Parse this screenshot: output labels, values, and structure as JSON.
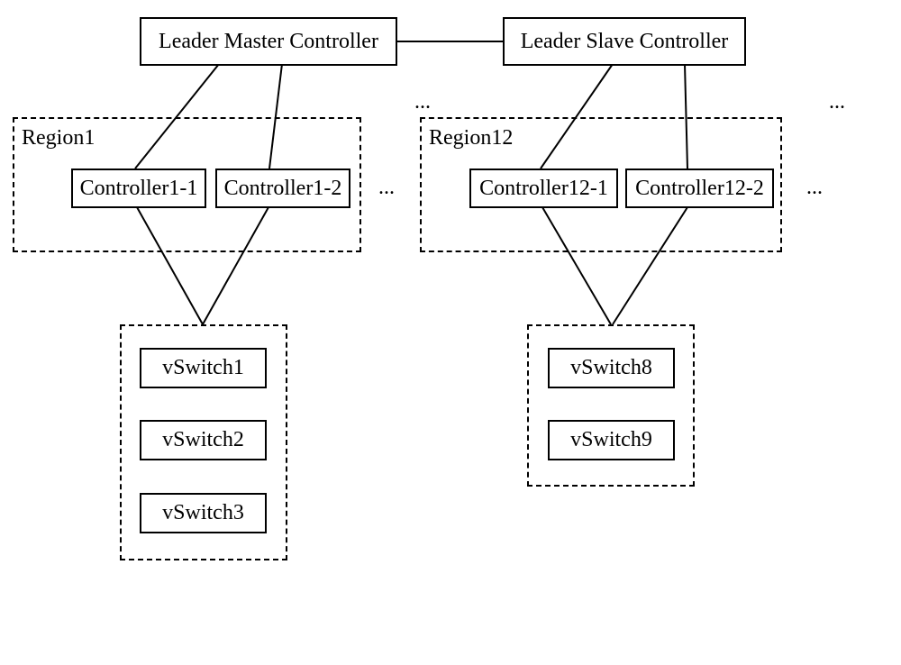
{
  "leaders": {
    "master": "Leader Master Controller",
    "slave": "Leader Slave Controller"
  },
  "region1": {
    "label": "Region1",
    "controllers": [
      "Controller1-1",
      "Controller1-2"
    ]
  },
  "region12": {
    "label": "Region12",
    "controllers": [
      "Controller12-1",
      "Controller12-2"
    ]
  },
  "switches_left": [
    "vSwitch1",
    "vSwitch2",
    "vSwitch3"
  ],
  "switches_right": [
    "vSwitch8",
    "vSwitch9"
  ],
  "ellipsis": "..."
}
